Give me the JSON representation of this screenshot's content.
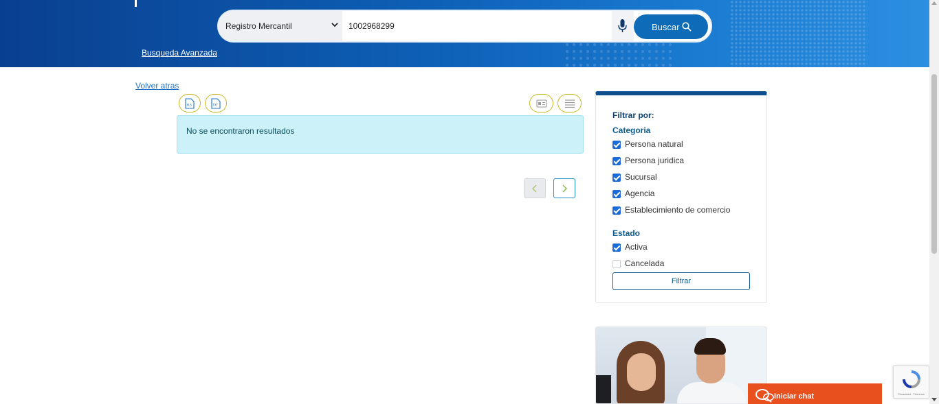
{
  "header": {
    "search": {
      "registry_selected": "Registro Mercantil",
      "query_value": "1002968299",
      "button_label": "Buscar"
    },
    "advanced_link": "Busqueda Avanzada"
  },
  "content": {
    "back_link": "Volver atras",
    "export_icons": [
      "xls-file-icon",
      "txt-file-icon"
    ],
    "view_icons": [
      "card-view-icon",
      "list-view-icon"
    ],
    "no_results": "No se encontraron resultados"
  },
  "filters": {
    "title": "Filtrar por:",
    "categoria_title": "Categoria",
    "categoria": [
      {
        "label": "Persona natural",
        "checked": true
      },
      {
        "label": "Persona juridica",
        "checked": true
      },
      {
        "label": "Sucursal",
        "checked": true
      },
      {
        "label": "Agencia",
        "checked": true
      },
      {
        "label": "Establecimiento de comercio",
        "checked": true
      }
    ],
    "estado_title": "Estado",
    "estado": [
      {
        "label": "Activa",
        "checked": true
      },
      {
        "label": "Cancelada",
        "checked": false
      }
    ],
    "button_label": "Filtrar"
  },
  "chat": {
    "label": "Iniciar chat"
  },
  "recaptcha": {
    "text": "Privacidad - Términos"
  },
  "colors": {
    "header_blue": "#0d5fb5",
    "button_blue": "#0e6bb8",
    "chat_orange": "#e8501e",
    "alert_bg": "#cdf1f8"
  }
}
